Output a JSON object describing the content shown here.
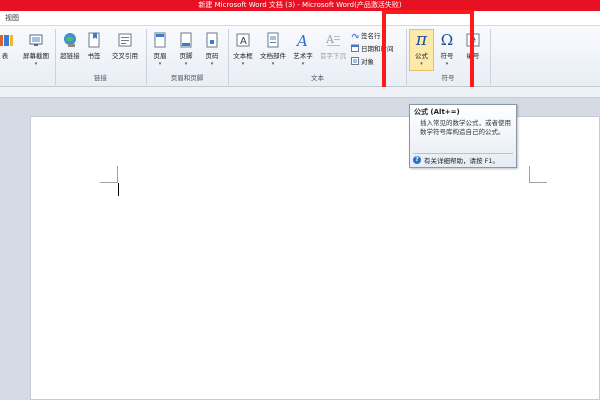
{
  "window": {
    "title": "新建 Microsoft Word 文档 (3) - Microsoft Word(产品激活失败)"
  },
  "menu": {
    "view_tab": "视图"
  },
  "ribbon": {
    "buttons": {
      "table": "表",
      "screenshot": "屏幕截图",
      "hyperlink": "超链接",
      "bookmark": "书签",
      "cross_reference": "交叉引用",
      "header": "页眉",
      "footer": "页脚",
      "page_number": "页码",
      "textbox": "文本框",
      "quick_parts": "文档部件",
      "wordart": "艺术字",
      "drop_cap": "首字下沉",
      "signature_line": "签名行",
      "date_time": "日期和时间",
      "object": "对象",
      "equation": "公式",
      "symbol": "符号",
      "number": "编号"
    },
    "groups": {
      "links": "链接",
      "header_footer": "页眉和页脚",
      "text": "文本",
      "symbols": "符号"
    },
    "icons": {
      "equation": "π",
      "symbol": "Ω"
    }
  },
  "tooltip": {
    "title": "公式 (Alt+=)",
    "description": "插入常见的数学公式，或者使用数学符号库构造自己的公式。",
    "help": "有关详细帮助，请按 F1。"
  },
  "colors": {
    "titlebar": "#e81123",
    "highlight": "#ff1a1a",
    "hover": "#fde9a8"
  }
}
